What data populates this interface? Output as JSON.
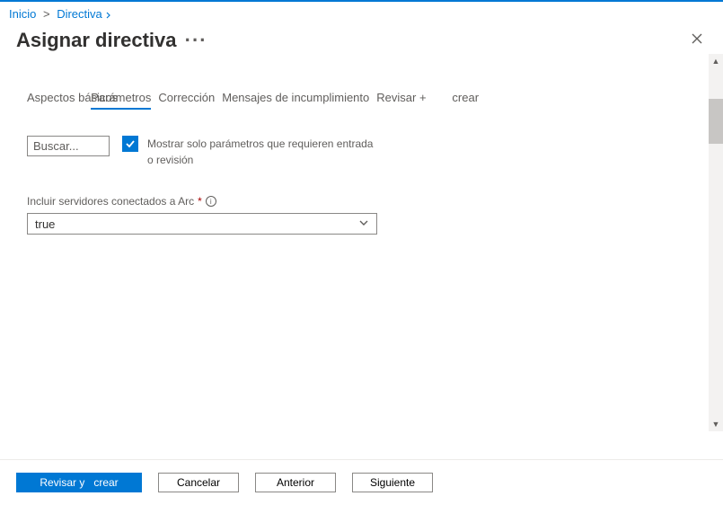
{
  "breadcrumb": {
    "home": "Inicio",
    "policy": "Directiva"
  },
  "header": {
    "title": "Asignar directiva"
  },
  "tabs": {
    "basics": "Aspectos básicos",
    "parameters": "Parámetros",
    "remediation": "Corrección",
    "noncompliance": "Mensajes de incumplimiento",
    "review_create": "Revisar +        crear"
  },
  "search": {
    "placeholder": "Buscar..."
  },
  "checkbox": {
    "label": "Mostrar solo parámetros que requieren entrada o revisión",
    "checked": true
  },
  "field": {
    "label": "Incluir servidores conectados a Arc",
    "required": "*",
    "value": "true"
  },
  "footer": {
    "review_create": "Revisar y   crear",
    "cancel": "Cancelar",
    "previous": "Anterior",
    "next": "Siguiente"
  }
}
